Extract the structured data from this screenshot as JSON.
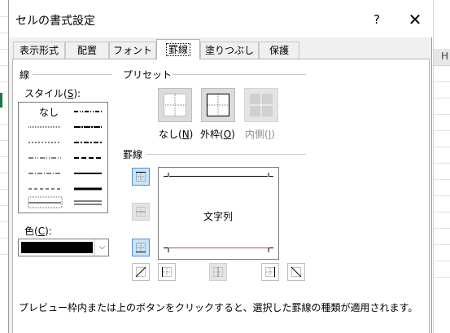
{
  "background": {
    "sheet_column_header": "H",
    "accent_color": "#217346"
  },
  "dialog": {
    "title": "セルの書式設定",
    "help_label": "?",
    "close_label": "✕"
  },
  "tabs": [
    {
      "label": "表示形式",
      "active": false
    },
    {
      "label": "配置",
      "active": false
    },
    {
      "label": "フォント",
      "active": false
    },
    {
      "label": "罫線",
      "active": true
    },
    {
      "label": "塗りつぶし",
      "active": false
    },
    {
      "label": "保護",
      "active": false
    }
  ],
  "line_group": {
    "title": "線",
    "style_label": "スタイル(S):",
    "none_label": "なし",
    "color_label": "色(C):",
    "color_value": "#000000"
  },
  "presets": {
    "title": "プリセット",
    "none": "なし(N)",
    "outline": "外枠(O)",
    "inside": "内側(I)"
  },
  "border": {
    "title": "罫線",
    "preview_text": "文字列",
    "top_line_color": "#000000",
    "bottom_line_color": "#c0504d"
  },
  "footer": {
    "text": "プレビュー枠内または上のボタンをクリックすると、選択した罫線の種類が適用されます。"
  }
}
